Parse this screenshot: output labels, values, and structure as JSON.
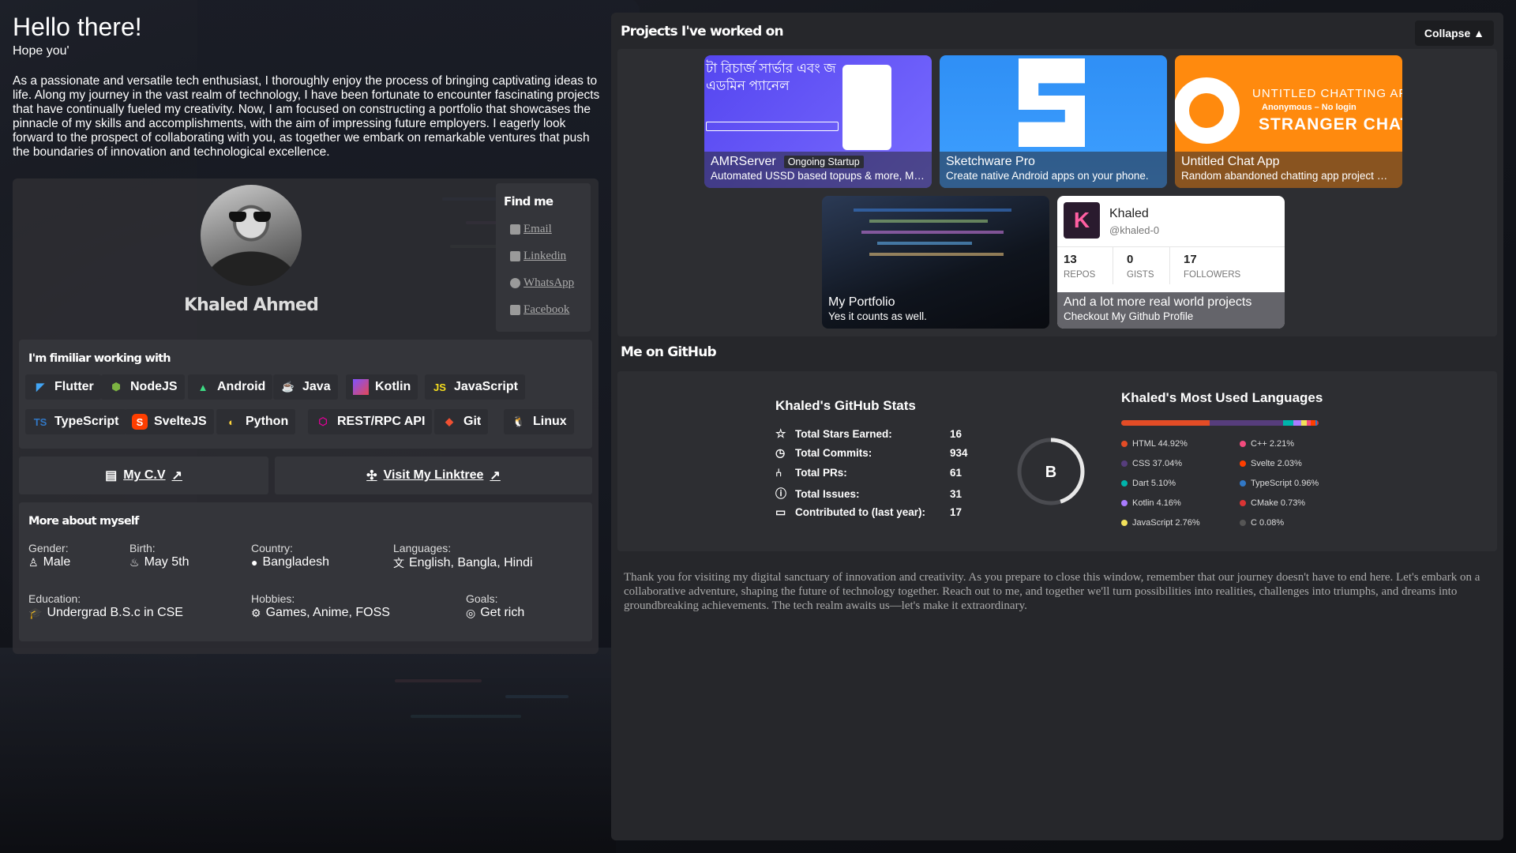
{
  "hero": {
    "greeting": "Hello there!",
    "subtitle": "Hope you'",
    "intro": "As a passionate and versatile tech enthusiast, I thoroughly enjoy the process of bringing captivating ideas to life. Along my journey in the vast realm of technology, I have been fortunate to encounter fascinating projects that have continually fueled my creativity. Now, I am focused on constructing a portfolio that showcases the pinnacle of my skills and accomplishments, with the aim of impressing future employers. I eagerly look forward to the prospect of collaborating with you, as together we embark on remarkable ventures that push the boundaries of innovation and technological excellence."
  },
  "profile": {
    "name": "Khaled Ahmed"
  },
  "findme": {
    "title": "Find me",
    "links": [
      {
        "label": "Email",
        "icon": "envelope-icon"
      },
      {
        "label": "Linkedin",
        "icon": "linkedin-icon"
      },
      {
        "label": "WhatsApp",
        "icon": "whatsapp-icon"
      },
      {
        "label": "Facebook",
        "icon": "facebook-icon"
      }
    ]
  },
  "skills": {
    "title": "I'm fimiliar working with",
    "items": [
      {
        "label": "Flutter",
        "icon": "flutter-icon",
        "color": "#42a5f5"
      },
      {
        "label": "NodeJS",
        "icon": "nodejs-icon",
        "color": "#7cb342"
      },
      {
        "label": "Android",
        "icon": "android-icon",
        "color": "#3ddc84"
      },
      {
        "label": "Java",
        "icon": "java-icon",
        "color": "#f89820"
      },
      {
        "label": "Kotlin",
        "icon": "kotlin-icon",
        "color": "#a97bff"
      },
      {
        "label": "JavaScript",
        "icon": "javascript-icon",
        "color": "#f7df1e"
      },
      {
        "label": "TypeScript",
        "icon": "typescript-icon",
        "color": "#3178c6"
      },
      {
        "label": "SvelteJS",
        "icon": "svelte-icon",
        "color": "#ff3e00"
      },
      {
        "label": "Python",
        "icon": "python-icon",
        "color": "#ffd43b"
      },
      {
        "label": "REST/RPC API",
        "icon": "graphql-icon",
        "color": "#e10098"
      },
      {
        "label": "Git",
        "icon": "git-icon",
        "color": "#f05032"
      },
      {
        "label": "Linux",
        "icon": "linux-icon",
        "color": "#ffffff"
      }
    ]
  },
  "buttons": {
    "cv": "My C.V",
    "linktree": "Visit My Linktree"
  },
  "about": {
    "title": "More about myself",
    "gender_label": "Gender:",
    "gender": "Male",
    "birth_label": "Birth:",
    "birth": "May 5th",
    "country_label": "Country:",
    "country": "Bangladesh",
    "languages_label": "Languages:",
    "languages": "English, Bangla, Hindi",
    "education_label": "Education:",
    "education": "Undergrad B.S.c in CSE",
    "hobbies_label": "Hobbies:",
    "hobbies": "Games, Anime, FOSS",
    "goals_label": "Goals:",
    "goals": "Get rich"
  },
  "projects": {
    "title": "Projects I've worked on",
    "collapse": "Collapse ▲",
    "items": [
      {
        "title": "AMRServer",
        "badge": "Ongoing Startup",
        "desc": "Automated USSD based topups & more, M…",
        "thumb_text": "টা রিচার্জ সার্ভার এবং জ এডমিন প্যানেল",
        "color": "#6a5cf6"
      },
      {
        "title": "Sketchware Pro",
        "badge": "",
        "desc": "Create native Android apps on your phone.",
        "thumb_text": "",
        "color": "#2f8ff5"
      },
      {
        "title": "Untitled Chat App",
        "badge": "",
        "desc": "Random abandoned chatting app project m…",
        "thumb_text": "UNTITLED CHATTING API",
        "thumb_sub": "Anonymous – No login",
        "thumb_big": "STRANGER CHAT",
        "color": "#ff8a0e"
      },
      {
        "title": "My Portfolio",
        "badge": "",
        "desc": "Yes it counts as well.",
        "thumb_text": "",
        "color": "#1b2433"
      },
      {
        "title": "And a lot more real world projects",
        "badge": "",
        "desc": "Checkout My Github Profile",
        "thumb_text": "",
        "color": "#ffffff"
      }
    ],
    "github_card": {
      "name": "Khaled",
      "handle": "@khaled-0",
      "repos": "13",
      "repos_label": "REPOS",
      "gists": "0",
      "gists_label": "GISTS",
      "followers": "17",
      "followers_label": "FOLLOWERS"
    }
  },
  "github": {
    "title": "Me on GitHub",
    "stats_title": "Khaled's GitHub Stats",
    "stats": [
      {
        "label": "Total Stars Earned:",
        "value": "16"
      },
      {
        "label": "Total Commits:",
        "value": "934"
      },
      {
        "label": "Total PRs:",
        "value": "61"
      },
      {
        "label": "Total Issues:",
        "value": "31"
      },
      {
        "label": "Contributed to (last year):",
        "value": "17"
      }
    ],
    "rank": "B",
    "rank_progress": 0.45,
    "langs_title": "Khaled's Most Used Languages",
    "languages": [
      {
        "label": "HTML 44.92%",
        "pct": 44.92,
        "color": "#e34c26"
      },
      {
        "label": "CSS 37.04%",
        "pct": 37.04,
        "color": "#563d7c"
      },
      {
        "label": "Dart 5.10%",
        "pct": 5.1,
        "color": "#00b4ab"
      },
      {
        "label": "Kotlin 4.16%",
        "pct": 4.16,
        "color": "#a97bff"
      },
      {
        "label": "JavaScript 2.76%",
        "pct": 2.76,
        "color": "#f1e05a"
      },
      {
        "label": "C++ 2.21%",
        "pct": 2.21,
        "color": "#f34b7d"
      },
      {
        "label": "Svelte 2.03%",
        "pct": 2.03,
        "color": "#ff3e00"
      },
      {
        "label": "TypeScript 0.96%",
        "pct": 0.96,
        "color": "#3178c6"
      },
      {
        "label": "CMake 0.73%",
        "pct": 0.73,
        "color": "#da3434"
      },
      {
        "label": "C 0.08%",
        "pct": 0.08,
        "color": "#555555"
      }
    ]
  },
  "outro": "Thank you for visiting my digital sanctuary of innovation and creativity. As you prepare to close this window, remember that our journey doesn't have to end here. Let's embark on a collaborative adventure, shaping the future of technology together. Reach out to me, and together we'll turn possibilities into realities, challenges into triumphs, and dreams into groundbreaking achievements. The tech realm awaits us—let's make it extraordinary."
}
